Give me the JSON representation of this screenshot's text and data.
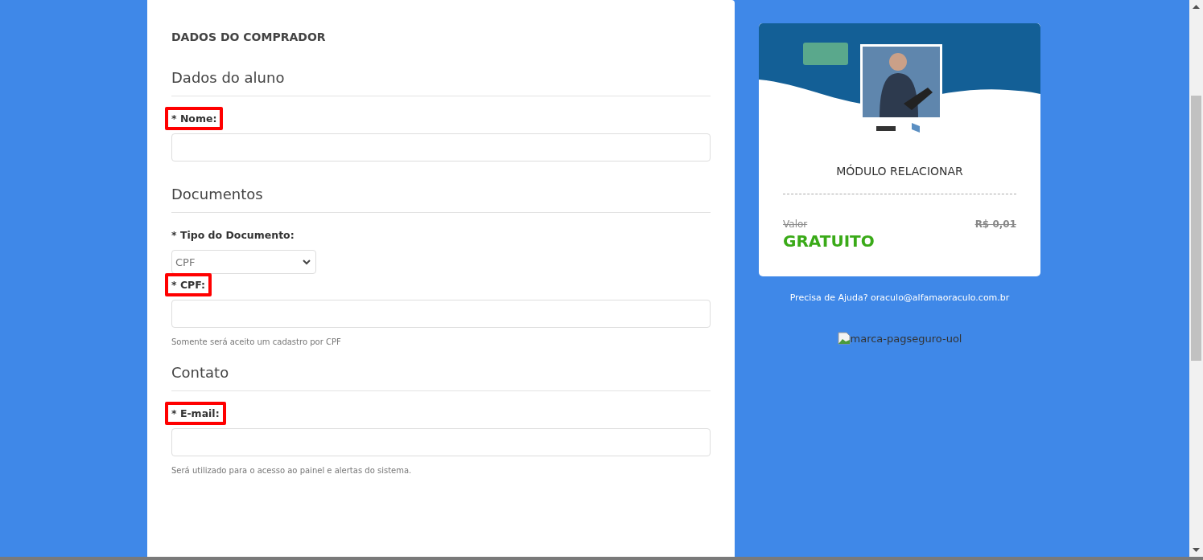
{
  "form": {
    "heading": "DADOS DO COMPRADOR",
    "sections": [
      {
        "title": "Dados do aluno",
        "fields": [
          {
            "kind": "text",
            "label": "* Nome:",
            "highlighted": true
          }
        ]
      },
      {
        "title": "Documentos",
        "fields": [
          {
            "kind": "select",
            "label": "* Tipo do Documento:",
            "highlighted": false,
            "value": "CPF"
          },
          {
            "kind": "text",
            "label": "* CPF:",
            "highlighted": true,
            "hint": "Somente será aceito um cadastro por CPF"
          }
        ]
      },
      {
        "title": "Contato",
        "fields": [
          {
            "kind": "text",
            "label": "* E-mail:",
            "highlighted": true,
            "hint": "Será utilizado para o acesso ao painel e alertas do sistema."
          }
        ]
      }
    ]
  },
  "product": {
    "title": "MÓDULO RELACIONAR",
    "price_label": "Valor",
    "old_price": "R$ 0,01",
    "price": "GRATUITO"
  },
  "help_text": "Precisa de Ajuda? oraculo@alfamaoraculo.com.br",
  "broken_image_alt": "marca-pagseguro-uol"
}
